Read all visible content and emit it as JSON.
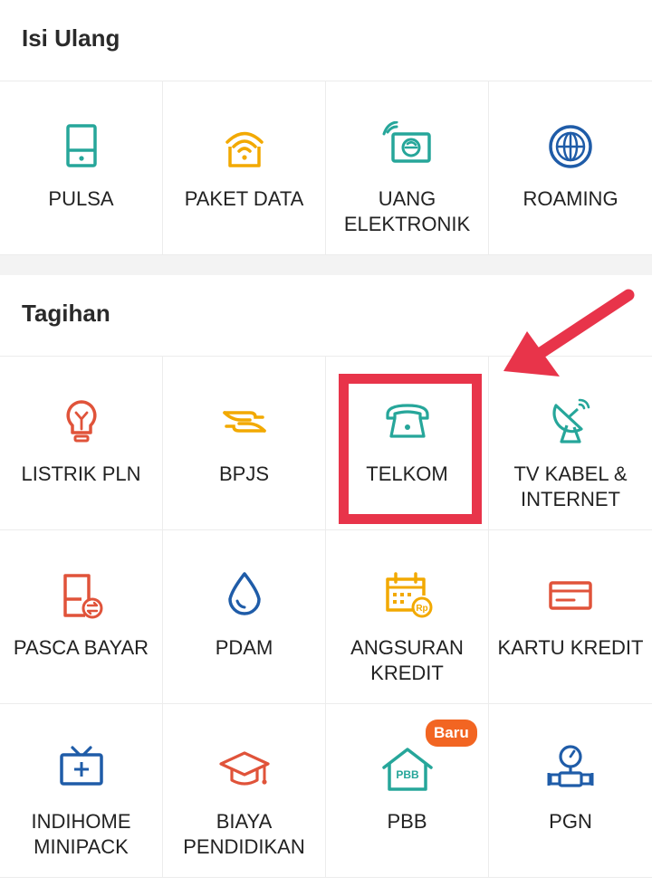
{
  "isi_ulang": {
    "title": "Isi Ulang",
    "items": [
      {
        "label": "PULSA",
        "icon": "phone-icon"
      },
      {
        "label": "PAKET DATA",
        "icon": "wifi-router-icon"
      },
      {
        "label": "UANG ELEKTRONIK",
        "icon": "e-money-card-icon"
      },
      {
        "label": "ROAMING",
        "icon": "globe-icon"
      }
    ]
  },
  "tagihan": {
    "title": "Tagihan",
    "items": [
      {
        "label": "LISTRIK PLN",
        "icon": "lightbulb-icon"
      },
      {
        "label": "BPJS",
        "icon": "hands-icon"
      },
      {
        "label": "TELKOM",
        "icon": "telephone-icon"
      },
      {
        "label": "TV KABEL & INTERNET",
        "icon": "satellite-dish-icon"
      },
      {
        "label": "PASCA BAYAR",
        "icon": "postpaid-phone-icon"
      },
      {
        "label": "PDAM",
        "icon": "water-drop-icon"
      },
      {
        "label": "ANGSURAN KREDIT",
        "icon": "calendar-rp-icon"
      },
      {
        "label": "KARTU KREDIT",
        "icon": "credit-card-icon"
      },
      {
        "label": "INDIHOME MINIPACK",
        "icon": "tv-icon"
      },
      {
        "label": "BIAYA PENDIDIKAN",
        "icon": "graduation-cap-icon"
      },
      {
        "label": "PBB",
        "icon": "house-pbb-icon",
        "badge": "Baru",
        "icon_text": "PBB"
      },
      {
        "label": "PGN",
        "icon": "gas-meter-icon"
      }
    ]
  },
  "colors": {
    "teal": "#26a69a",
    "orange": "#f2a900",
    "red_orange": "#e0533a",
    "blue": "#1f5ca8",
    "badge": "#f26522",
    "highlight": "#e8344a"
  }
}
